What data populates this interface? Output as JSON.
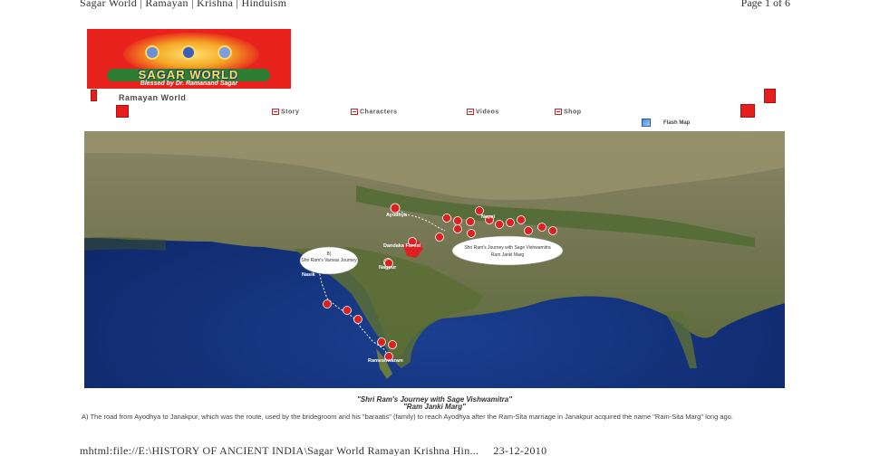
{
  "header": {
    "title": "Sagar World | Ramayan | Krishna | Hinduism",
    "page": "Page 1 of 6"
  },
  "logo": {
    "brand": "SAGAR WORLD",
    "tagline": "Blessed by Dr. Ramanand Sagar"
  },
  "page_title": "Ramayan World",
  "nav": {
    "items": [
      {
        "label": "Story"
      },
      {
        "label": "Characters"
      },
      {
        "label": "Videos"
      },
      {
        "label": "Shop"
      }
    ],
    "flash_map": "Flash Map"
  },
  "map": {
    "labels": {
      "ayodhya": "Ayodhya",
      "nepal": "Nepal",
      "dandaka": "Dandaka Forest",
      "nagpur": "Nagpur",
      "nasik": "Nasik",
      "rameshwaram": "Rameshwaram"
    },
    "bubble_vanvas_num": "B)",
    "bubble_vanvas": "Shri Ram's Vanvas Journey",
    "bubble_janki": "Shri Ram's Journey with Sage Vishwamitra",
    "bubble_janki_sub": "Ram Janki Marg",
    "colors": {
      "marker": "#e02020",
      "ocean": "#0f2a6b",
      "land": "#6e7a48"
    }
  },
  "caption": {
    "line1": "\"Shri Ram's Journey with Sage Vishwamitra\"",
    "line2": "\"Ram Janki Marg\""
  },
  "paragraph": "A) The road from Ayodhya to Janakpur, which was the route, used by the bridegroom and his \"baraatis\" (family) to reach Ayodhya after the Ram-Sita marriage in Janakpur acquired the name \"Ram-Sita Marg\" long ago.",
  "footer": {
    "path": "mhtml:file://E:\\HISTORY OF ANCIENT INDIA\\Sagar World Ramayan Krishna Hin...",
    "date": "23-12-2010"
  }
}
